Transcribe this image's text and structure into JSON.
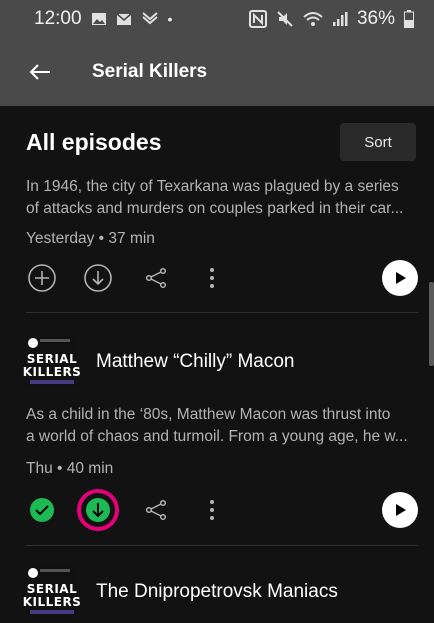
{
  "status_bar": {
    "time": "12:00",
    "battery": "36%"
  },
  "app_bar": {
    "title": "Serial Killers"
  },
  "section": {
    "title": "All episodes",
    "sort_label": "Sort"
  },
  "episode1": {
    "description_line1": "In 1946, the city of Texarkana was plagued by a series",
    "description_line2": "of attacks and murders on couples parked in their car...",
    "meta": "Yesterday • 37 min"
  },
  "episode2": {
    "thumb_line1": "SERIAL",
    "thumb_line2": "KILLERS",
    "title": "Matthew “Chilly” Macon",
    "description_line1": "As a child in the ‘80s, Matthew Macon was thrust into",
    "description_line2": "a world of chaos and turmoil. From a young age, he w...",
    "meta": "Thu • 40 min"
  },
  "episode3": {
    "thumb_line1": "SERIAL",
    "thumb_line2": "KILLERS",
    "title": "The Dnipropetrovsk Maniacs"
  },
  "colors": {
    "accent_green": "#1db954",
    "highlight_ring": "#e6007a",
    "background": "#121212",
    "header": "#4a4a4a"
  },
  "icons": [
    "back-arrow-icon",
    "add-icon",
    "download-icon",
    "share-icon",
    "more-icon",
    "play-icon",
    "downloaded-check-icon"
  ]
}
